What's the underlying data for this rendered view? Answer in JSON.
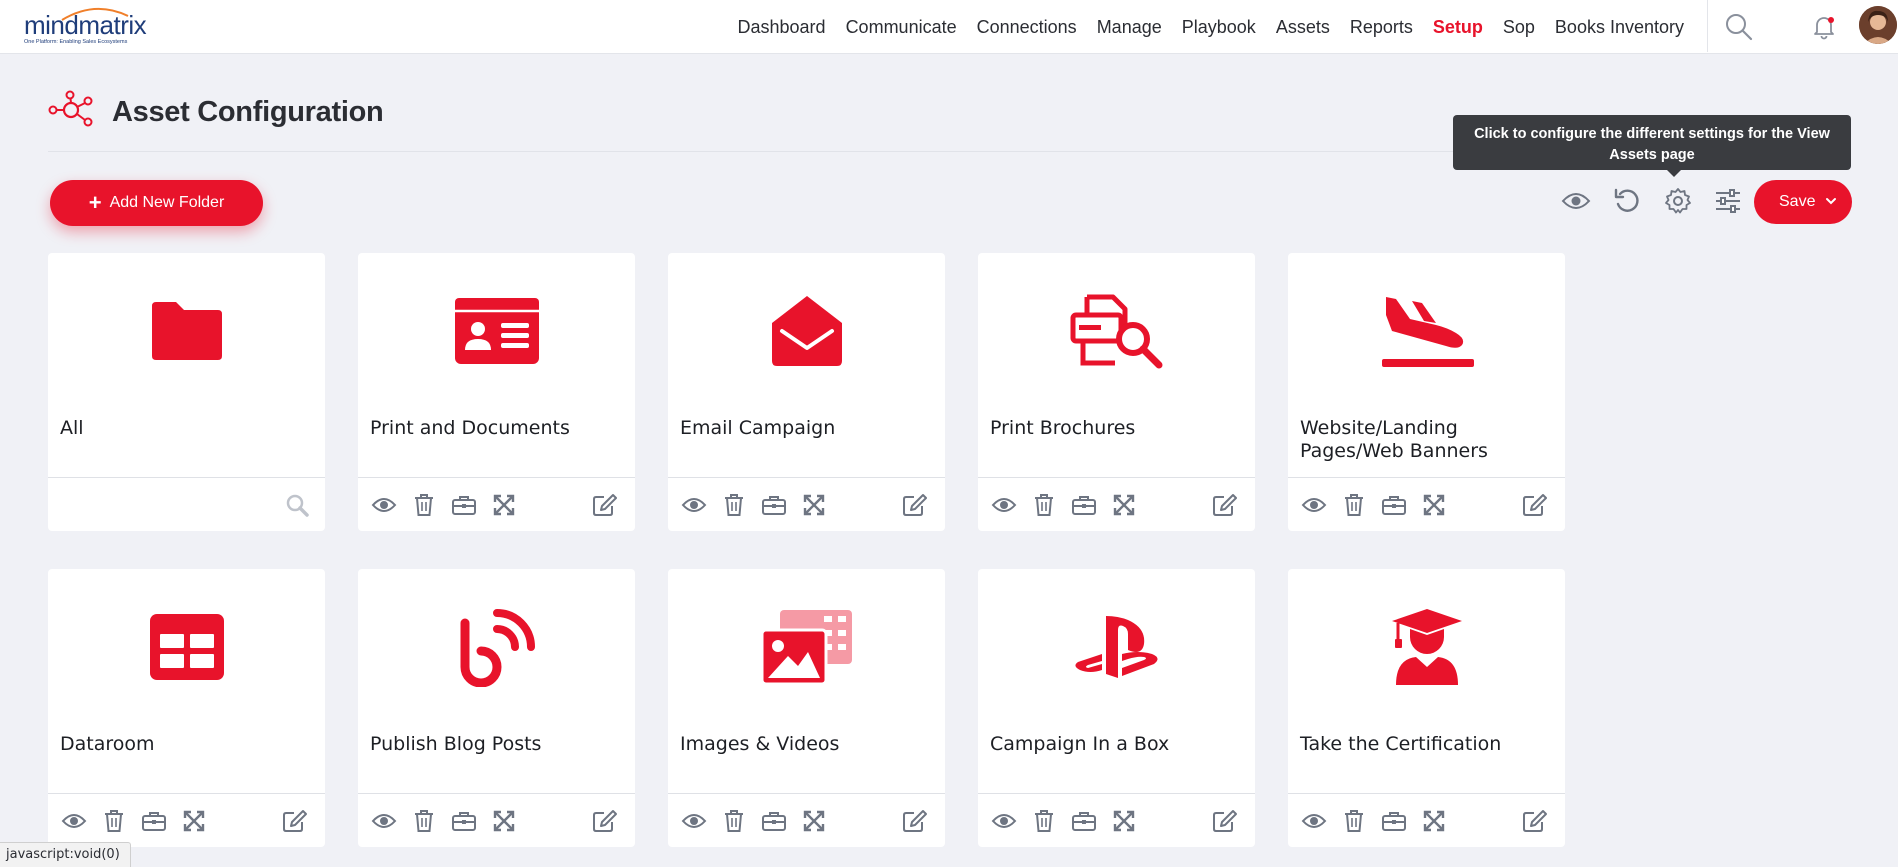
{
  "brand": {
    "name": "mindmatrix",
    "tagline": "One Platform: Enabling Sales Ecosystems",
    "accent": "#e8132b",
    "navy": "#1f3d7a"
  },
  "nav": {
    "items": [
      {
        "label": "Dashboard",
        "active": false
      },
      {
        "label": "Communicate",
        "active": false
      },
      {
        "label": "Connections",
        "active": false
      },
      {
        "label": "Manage",
        "active": false
      },
      {
        "label": "Playbook",
        "active": false
      },
      {
        "label": "Assets",
        "active": false
      },
      {
        "label": "Reports",
        "active": false
      },
      {
        "label": "Setup",
        "active": true
      },
      {
        "label": "Sop",
        "active": false
      },
      {
        "label": "Books Inventory",
        "active": false
      }
    ],
    "icons": [
      "search-icon",
      "bell-icon",
      "avatar"
    ]
  },
  "page": {
    "title": "Asset Configuration",
    "title_icon": "network-icon"
  },
  "toolbar": {
    "add_folder_label": "Add New Folder",
    "save_label": "Save",
    "icons": [
      "eye-icon",
      "undo-icon",
      "gear-icon",
      "sliders-icon"
    ],
    "tooltip": "Click to configure the different settings for the View Assets page"
  },
  "cards": [
    {
      "label": "All",
      "icon": "folder-icon",
      "footer": "search"
    },
    {
      "label": "Print and Documents",
      "icon": "id-card-icon",
      "footer": "actions"
    },
    {
      "label": "Email Campaign",
      "icon": "envelope-open-icon",
      "footer": "actions"
    },
    {
      "label": "Print Brochures",
      "icon": "file-search-icon",
      "footer": "actions"
    },
    {
      "label": "Website/Landing Pages/Web Banners",
      "icon": "plane-landing-icon",
      "footer": "actions"
    },
    {
      "label": "Dataroom",
      "icon": "grid-table-icon",
      "footer": "actions"
    },
    {
      "label": "Publish Blog Posts",
      "icon": "blog-icon",
      "footer": "actions"
    },
    {
      "label": "Images & Videos",
      "icon": "photo-film-icon",
      "footer": "actions"
    },
    {
      "label": "Campaign In a Box",
      "icon": "playstation-icon",
      "footer": "actions"
    },
    {
      "label": "Take the Certification",
      "icon": "graduate-icon",
      "footer": "actions"
    }
  ],
  "card_actions": [
    "eye-icon",
    "trash-icon",
    "briefcase-icon",
    "expand-icon",
    "edit-icon"
  ],
  "status_bar": "javascript:void(0)"
}
